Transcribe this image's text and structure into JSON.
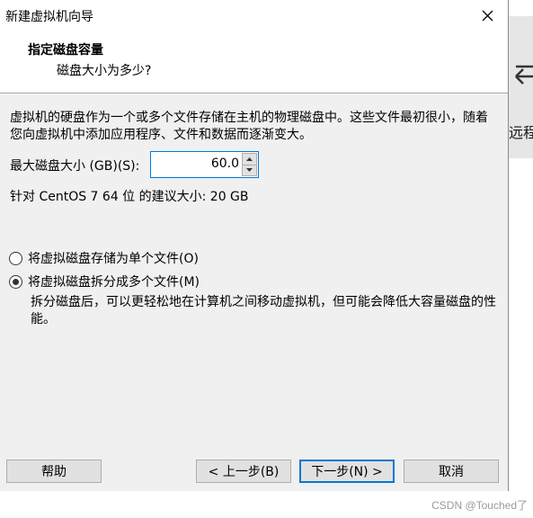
{
  "window": {
    "title": "新建虚拟机向导"
  },
  "header": {
    "title": "指定磁盘容量",
    "subtitle": "磁盘大小为多少?"
  },
  "content": {
    "description": "虚拟机的硬盘作为一个或多个文件存储在主机的物理磁盘中。这些文件最初很小，随着您向虚拟机中添加应用程序、文件和数据而逐渐变大。",
    "size_label": "最大磁盘大小 (GB)(S):",
    "size_value": "60.0",
    "recommend": "针对 CentOS 7 64 位 的建议大小: 20 GB",
    "options": [
      {
        "label": "将虚拟磁盘存储为单个文件(O)",
        "checked": false
      },
      {
        "label": "将虚拟磁盘拆分成多个文件(M)",
        "checked": true
      }
    ],
    "split_description": "拆分磁盘后，可以更轻松地在计算机之间移动虚拟机，但可能会降低大容量磁盘的性能。"
  },
  "footer": {
    "help": "帮助",
    "back": "< 上一步(B)",
    "next": "下一步(N) >",
    "cancel": "取消"
  },
  "background": {
    "text": "远程"
  },
  "watermark": "CSDN @Touched了"
}
